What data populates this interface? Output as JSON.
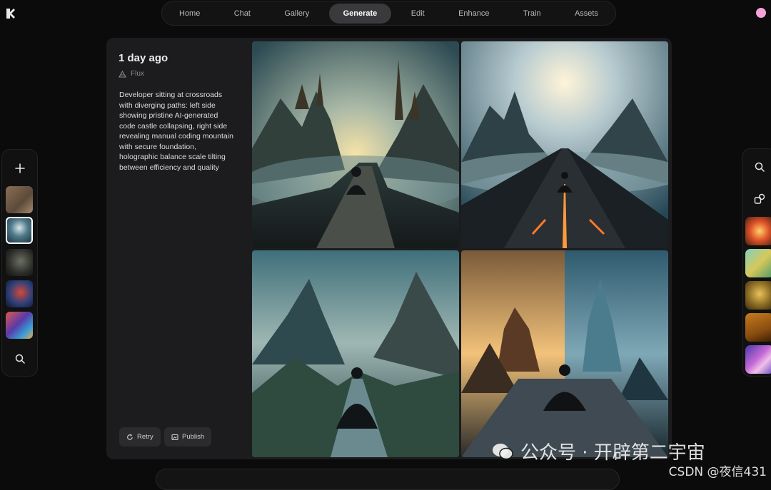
{
  "nav": {
    "items": [
      {
        "label": "Home"
      },
      {
        "label": "Chat"
      },
      {
        "label": "Gallery"
      },
      {
        "label": "Generate",
        "active": true
      },
      {
        "label": "Edit"
      },
      {
        "label": "Enhance"
      },
      {
        "label": "Train"
      },
      {
        "label": "Assets"
      }
    ]
  },
  "left_rail": {
    "add_icon": "plus-icon",
    "search_icon": "search-icon",
    "thumbnail_count": 5,
    "selected_index": 1
  },
  "right_rail": {
    "search_icon": "search-icon",
    "shapes_icon": "shapes-icon",
    "thumbnail_count": 5
  },
  "generation": {
    "timestamp": "1 day ago",
    "model": "Flux",
    "prompt": "Developer sitting at crossroads with diverging paths: left side showing pristine AI-generated code castle collapsing, right side revealing manual coding mountain with secure foundation, holographic balance scale tilting between efficiency and quality",
    "retry_label": "Retry",
    "publish_label": "Publish"
  },
  "watermark": {
    "wechat": "公众号 · 开辟第二宇宙",
    "csdn": "CSDN @夜信431"
  },
  "colors": {
    "background": "#0b0b0c",
    "panel": "#1c1c1e",
    "nav_active": "#3a3a3d",
    "avatar": "#f4a3d9"
  }
}
